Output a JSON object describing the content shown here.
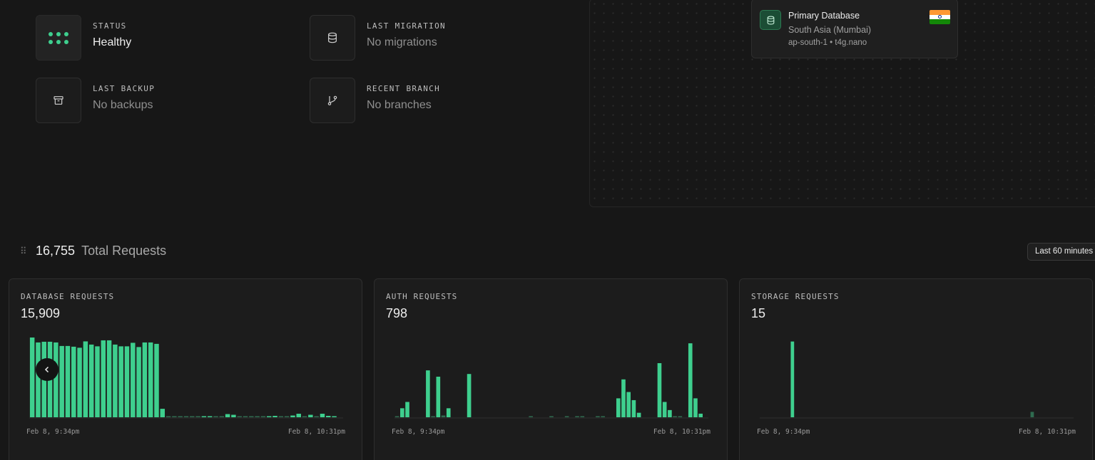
{
  "stats": [
    {
      "label": "STATUS",
      "value": "Healthy",
      "icon": "status-dots-icon"
    },
    {
      "label": "LAST MIGRATION",
      "value": "No migrations",
      "icon": "database-icon"
    },
    {
      "label": "LAST BACKUP",
      "value": "No backups",
      "icon": "archive-icon"
    },
    {
      "label": "RECENT BRANCH",
      "value": "No branches",
      "icon": "git-branch-icon"
    }
  ],
  "database": {
    "title": "Primary Database",
    "region": "South Asia (Mumbai)",
    "subtitle": "ap-south-1 • t4g.nano",
    "flag": "india-flag-icon"
  },
  "requests": {
    "total": "16,755",
    "label": "Total Requests",
    "range_button": "Last 60 minutes"
  },
  "colors": {
    "accent": "#3ecf8e",
    "background": "#171717",
    "card": "#1c1c1c"
  },
  "chart_data": [
    {
      "type": "bar",
      "title": "DATABASE REQUESTS",
      "total": "15,909",
      "x_start_label": "Feb 8, 9:34pm",
      "x_end_label": "Feb 8, 10:31pm",
      "values": [
        452,
        424,
        428,
        428,
        424,
        404,
        404,
        400,
        394,
        430,
        412,
        402,
        436,
        436,
        412,
        402,
        402,
        422,
        398,
        424,
        424,
        416,
        48,
        2,
        2,
        2,
        2,
        2,
        2,
        4,
        4,
        2,
        2,
        18,
        14,
        2,
        2,
        2,
        2,
        2,
        4,
        8,
        2,
        2,
        10,
        20,
        2,
        14,
        2,
        20,
        8,
        4,
        0
      ],
      "ylim": [
        0,
        460
      ]
    },
    {
      "type": "bar",
      "title": "AUTH REQUESTS",
      "total": "798",
      "x_start_label": "Feb 8, 9:34pm",
      "x_end_label": "Feb 8, 10:31pm",
      "values": [
        1,
        10,
        17,
        0,
        0,
        0,
        52,
        1,
        45,
        2,
        10,
        0,
        0,
        0,
        48,
        0,
        0,
        0,
        0,
        0,
        0,
        0,
        0,
        0,
        0,
        0,
        1,
        0,
        0,
        0,
        1,
        0,
        0,
        1,
        0,
        1,
        1,
        0,
        0,
        1,
        1,
        0,
        0,
        21,
        42,
        28,
        19,
        5,
        0,
        0,
        0,
        60,
        17,
        8,
        1,
        1,
        0,
        82,
        21,
        4,
        0
      ],
      "ylim": [
        0,
        90
      ]
    },
    {
      "type": "bar",
      "title": "STORAGE REQUESTS",
      "total": "15",
      "x_start_label": "Feb 8, 9:34pm",
      "x_end_label": "Feb 8, 10:31pm",
      "values": [
        0,
        0,
        0,
        0,
        0,
        0,
        0,
        14,
        0,
        0,
        0,
        0,
        0,
        0,
        0,
        0,
        0,
        0,
        0,
        0,
        0,
        0,
        0,
        0,
        0,
        0,
        0,
        0,
        0,
        0,
        0,
        0,
        0,
        0,
        0,
        0,
        0,
        0,
        0,
        0,
        0,
        0,
        0,
        0,
        0,
        0,
        0,
        0,
        0,
        0,
        0,
        0,
        0,
        0,
        0,
        0,
        0,
        0,
        0,
        0,
        0,
        0,
        1,
        0,
        0,
        0,
        0,
        0,
        0,
        0,
        0,
        0
      ],
      "ylim": [
        0,
        15
      ]
    }
  ]
}
